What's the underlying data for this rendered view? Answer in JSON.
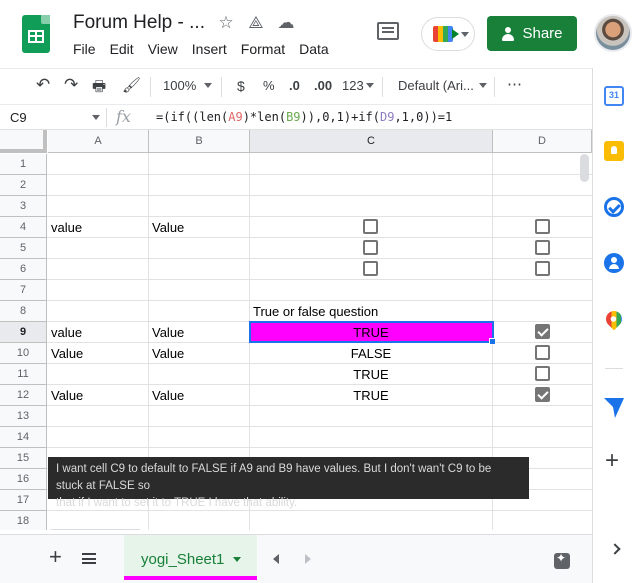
{
  "header": {
    "doc_title": "Forum Help - ...",
    "menu": [
      "File",
      "Edit",
      "View",
      "Insert",
      "Format",
      "Data"
    ],
    "share_label": "Share",
    "icons": [
      "star-icon",
      "move-to-drive-icon",
      "cloud-status-icon",
      "comment-icon",
      "meet-icon"
    ]
  },
  "toolbar": {
    "zoom": "100%",
    "currency": "$",
    "percent": "%",
    "dec_less": ".0",
    "dec_more": ".00",
    "more_formats": "123",
    "font": "Default (Ari...",
    "more": "⋯"
  },
  "formula_bar": {
    "name_box": "C9",
    "fx_label": "fx",
    "formula_parts": [
      "=(if((len(",
      "A9",
      ")*len(",
      "B9",
      ")),0,1)+if(",
      "D9",
      ",1,0))=1"
    ]
  },
  "grid": {
    "columns": [
      "A",
      "B",
      "C",
      "D"
    ],
    "rows": [
      "1",
      "2",
      "3",
      "4",
      "5",
      "6",
      "7",
      "8",
      "9",
      "10",
      "11",
      "12",
      "13",
      "14",
      "15",
      "16",
      "17",
      "18"
    ],
    "cells": {
      "a4": "value",
      "b4": "Value",
      "c8": "True or false question",
      "a9": "value",
      "b9": "Value",
      "c9": "TRUE",
      "a10": "Value",
      "b10": "Value",
      "c10": "FALSE",
      "c11": "TRUE",
      "a12": "Value",
      "b12": "Value",
      "c12": "TRUE"
    },
    "checkboxes": {
      "c4": false,
      "c5": false,
      "c6": false,
      "d4": false,
      "d5": false,
      "d6": false,
      "d9": true,
      "d10": false,
      "d11": false,
      "d12": true
    },
    "selected_cell": "C9",
    "highlight_color": "#ff00ff",
    "note_lines": [
      "I want cell C9 to default to FALSE if A9 and B9 have values. But I don't wan't C9 to be stuck at FALSE so",
      "that if I want to set it to TRUE I have that ability."
    ]
  },
  "tabs": {
    "sheet_name": "yogi_Sheet1",
    "accent_color": "#ff00ff"
  },
  "side_panel": {
    "calendar_day": "31"
  }
}
